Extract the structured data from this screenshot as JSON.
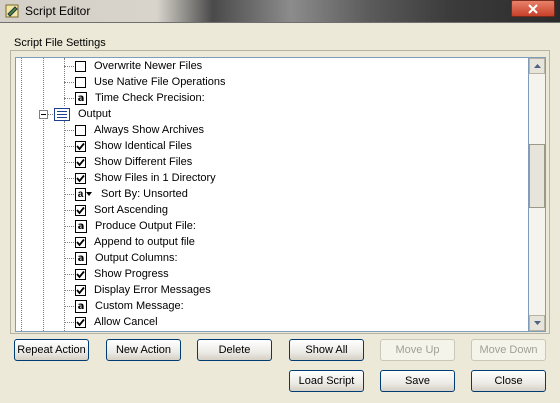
{
  "window": {
    "title": "Script Editor"
  },
  "group": {
    "label": "Script File Settings"
  },
  "tree": {
    "items": [
      {
        "kind": "check",
        "checked": false,
        "label": "Overwrite Newer Files",
        "icon": "checkbox-icon"
      },
      {
        "kind": "check",
        "checked": false,
        "label": "Use Native File Operations",
        "icon": "checkbox-icon"
      },
      {
        "kind": "text",
        "label": "Time Check Precision:",
        "icon": "text-field-icon"
      },
      {
        "kind": "folder",
        "label": "Output",
        "icon": "list-icon"
      },
      {
        "kind": "check",
        "checked": false,
        "label": "Always Show Archives",
        "icon": "checkbox-icon"
      },
      {
        "kind": "check",
        "checked": true,
        "label": "Show Identical Files",
        "icon": "checkbox-icon"
      },
      {
        "kind": "check",
        "checked": true,
        "label": "Show Different Files",
        "icon": "checkbox-icon"
      },
      {
        "kind": "check",
        "checked": true,
        "label": "Show Files in 1 Directory",
        "icon": "checkbox-icon"
      },
      {
        "kind": "combo",
        "label": "Sort By: Unsorted",
        "icon": "dropdown-field-icon"
      },
      {
        "kind": "check",
        "checked": true,
        "label": "Sort Ascending",
        "icon": "checkbox-icon"
      },
      {
        "kind": "text",
        "label": "Produce Output File:",
        "icon": "text-field-icon"
      },
      {
        "kind": "check",
        "checked": true,
        "label": "Append to output file",
        "icon": "checkbox-icon"
      },
      {
        "kind": "text",
        "label": "Output Columns:",
        "icon": "text-field-icon"
      },
      {
        "kind": "check",
        "checked": true,
        "label": "Show Progress",
        "icon": "checkbox-icon"
      },
      {
        "kind": "check",
        "checked": true,
        "label": "Display Error Messages",
        "icon": "checkbox-icon"
      },
      {
        "kind": "text",
        "label": "Custom Message:",
        "icon": "text-field-icon"
      },
      {
        "kind": "check",
        "checked": true,
        "label": "Allow Cancel",
        "icon": "checkbox-icon"
      }
    ]
  },
  "buttons": {
    "repeat_action": "Repeat Action",
    "new_action": "New Action",
    "delete": "Delete",
    "show_all": "Show All",
    "move_up": "Move Up",
    "move_down": "Move Down",
    "load_script": "Load Script",
    "save": "Save",
    "close": "Close"
  },
  "text_icon_glyph": "a",
  "colors": {
    "accent_border": "#003c74",
    "close_red": "#c7402a",
    "tree_border": "#7f9db9"
  }
}
